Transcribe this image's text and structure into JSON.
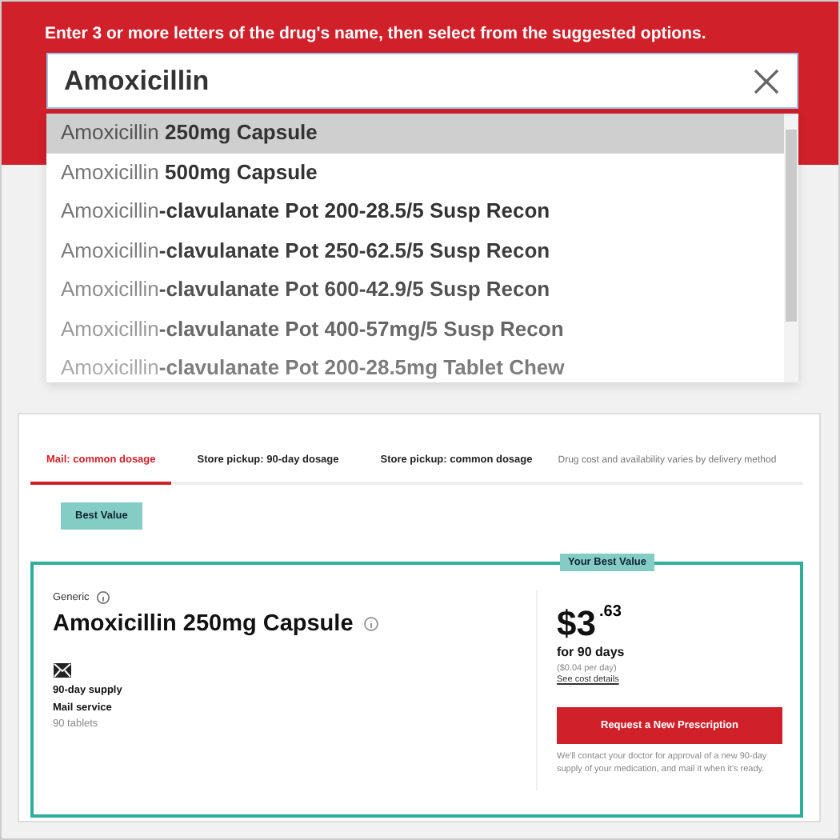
{
  "search": {
    "instruction": "Enter 3 or more letters of the drug's name, then select from the suggested options.",
    "value": "Amoxicillin",
    "suggestions": [
      {
        "text": "Amoxicillin **250mg Capsule**",
        "selected": true
      },
      {
        "text": "Amoxicillin **500mg Capsule**",
        "selected": false
      },
      {
        "text": "Amoxicillin**-clavulanate Pot 200-28.5/5 Susp Recon**",
        "selected": false
      },
      {
        "text": "Amoxicillin**-clavulanate Pot 250-62.5/5 Susp Recon**",
        "selected": false
      },
      {
        "text": "Amoxicillin**-clavulanate Pot 600-42.9/5 Susp Recon**",
        "selected": false
      },
      {
        "text": "Amoxicillin**-clavulanate Pot 400-57mg/5 Susp Recon**",
        "selected": false
      },
      {
        "text": "Amoxicillin**-clavulanate Pot 200-28.5mg Tablet Chew**",
        "selected": false
      }
    ]
  },
  "tabs": [
    {
      "label": "Mail: common dosage",
      "selected": true
    },
    {
      "label": "Store pickup: 90-day dosage",
      "selected": false
    },
    {
      "label": "Store pickup: common dosage",
      "selected": false
    }
  ],
  "delivery_note": "Drug cost and availability varies by delivery method",
  "tab_tooltip": "Best Value",
  "card": {
    "badge": "Your Best Value",
    "type_label": "Generic",
    "drug_name": "Amoxicillin 250mg Capsule",
    "supply": "90-day supply",
    "service": "Mail service",
    "quantity": "90 tablets",
    "price_whole": "$3",
    "price_cents": ".63",
    "period": "for 90 days",
    "per_day": "($0.04 per day)",
    "details_link": "See cost details",
    "button": "Request a New Prescription",
    "note": "We'll contact your doctor for approval of a new 90-day supply of your medication, and mail it when it's ready."
  }
}
